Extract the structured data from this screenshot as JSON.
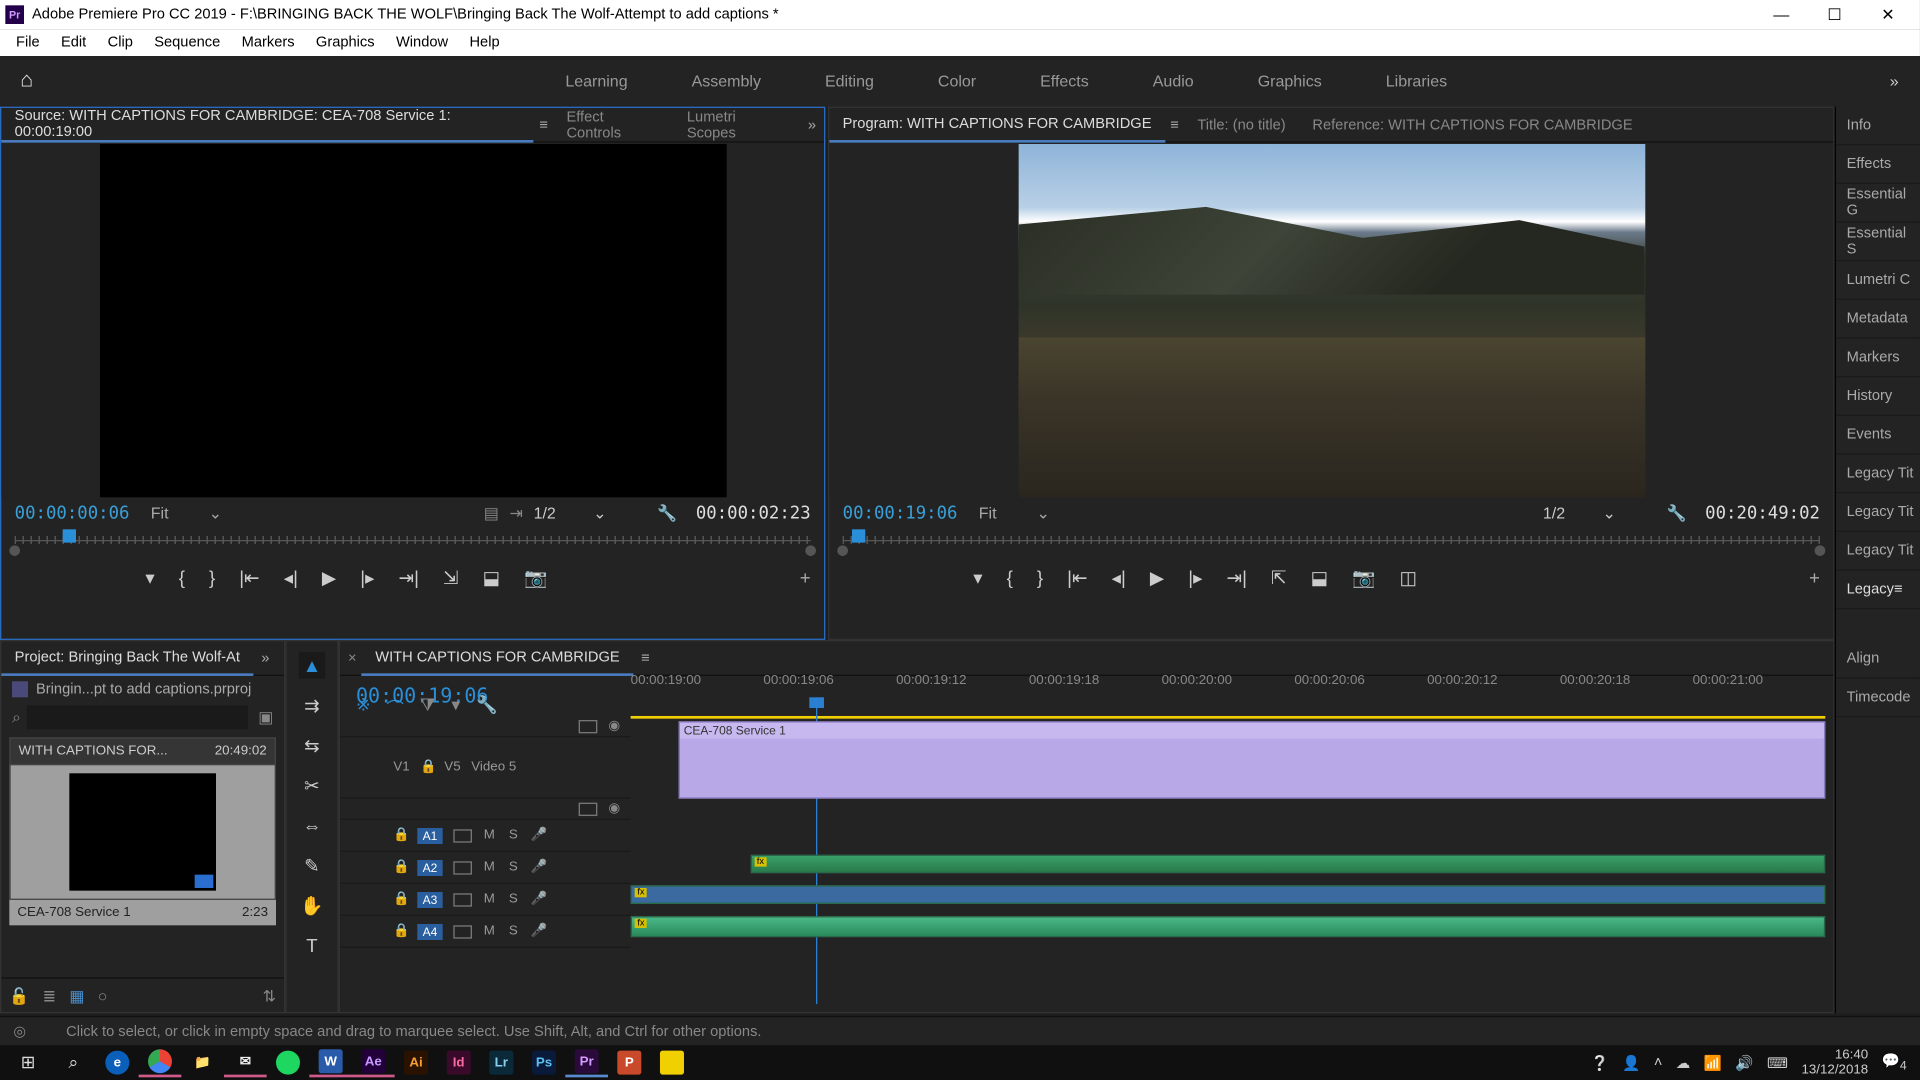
{
  "titlebar": {
    "icon_label": "Pr",
    "title": "Adobe Premiere Pro CC 2019 - F:\\BRINGING BACK THE WOLF\\Bringing Back The Wolf-Attempt to add captions *"
  },
  "menubar": [
    "File",
    "Edit",
    "Clip",
    "Sequence",
    "Markers",
    "Graphics",
    "Window",
    "Help"
  ],
  "workspaces": [
    "Learning",
    "Assembly",
    "Editing",
    "Color",
    "Effects",
    "Audio",
    "Graphics",
    "Libraries"
  ],
  "source": {
    "tab": "Source: WITH CAPTIONS FOR CAMBRIDGE: CEA-708 Service 1: 00:00:19:00",
    "tabs_other": [
      "Effect Controls",
      "Lumetri Scopes"
    ],
    "tc_left": "00:00:00:06",
    "fit": "Fit",
    "frac": "1/2",
    "tc_right": "00:00:02:23"
  },
  "program": {
    "tab": "Program: WITH CAPTIONS FOR CAMBRIDGE",
    "tabs_other": [
      "Title: (no title)",
      "Reference: WITH CAPTIONS FOR CAMBRIDGE"
    ],
    "tc_left": "00:00:19:06",
    "fit": "Fit",
    "frac": "1/2",
    "tc_right": "00:20:49:02"
  },
  "right_panels": [
    "Info",
    "Effects",
    "Essential G",
    "Essential S",
    "Lumetri C",
    "Metadata",
    "Markers",
    "History",
    "Events",
    "Legacy Tit",
    "Legacy Tit",
    "Legacy Tit",
    "Legacy",
    "Align",
    "Timecode"
  ],
  "right_panel_active": 12,
  "project": {
    "tab": "Project: Bringing Back The Wolf-At",
    "file": "Bringin...pt to add captions.prproj",
    "search_placeholder": "",
    "bin_name": "WITH CAPTIONS FOR...",
    "bin_dur": "20:49:02",
    "clip_name": "CEA-708 Service 1",
    "clip_dur": "2:23"
  },
  "timeline": {
    "tab": "WITH CAPTIONS FOR CAMBRIDGE",
    "tc": "00:00:19:06",
    "ruler": [
      "00:00:19:00",
      "00:00:19:06",
      "00:00:19:12",
      "00:00:19:18",
      "00:00:20:00",
      "00:00:20:06",
      "00:00:20:12",
      "00:00:20:18",
      "00:00:21:00"
    ],
    "video_track_label": "Video 5",
    "v_tag": "V1",
    "vs_tag": "V5",
    "caption_clip": "CEA-708 Service 1",
    "audio": [
      "A1",
      "A2",
      "A3",
      "A4"
    ],
    "fx_label": "fx"
  },
  "status": "Click to select, or click in empty space and drag to marquee select. Use Shift, Alt, and Ctrl for other options.",
  "taskbar": {
    "apps": [
      {
        "label": "⊞",
        "bg": "",
        "fg": "#fff"
      },
      {
        "label": "⌕",
        "bg": "",
        "fg": "#fff"
      },
      {
        "label": "e",
        "bg": "#0a5fba",
        "fg": "#fff"
      },
      {
        "label": "●",
        "bg": "",
        "fg": "#f2c43c",
        "chrome": true,
        "under": true
      },
      {
        "label": "📁",
        "bg": "",
        "fg": "#f2c43c"
      },
      {
        "label": "✉",
        "bg": "",
        "fg": "#eee",
        "under": true
      },
      {
        "label": "●",
        "bg": "#1ed760",
        "fg": "#000",
        "round": true
      },
      {
        "label": "W",
        "bg": "#2a5aaa",
        "fg": "#fff",
        "under": true
      },
      {
        "label": "Ae",
        "bg": "#22003a",
        "fg": "#c89aff",
        "under": true
      },
      {
        "label": "Ai",
        "bg": "#2a1200",
        "fg": "#f8a030"
      },
      {
        "label": "Id",
        "bg": "#3a0a2a",
        "fg": "#f86aa0"
      },
      {
        "label": "Lr",
        "bg": "#0a2a3a",
        "fg": "#8ad0f0"
      },
      {
        "label": "Ps",
        "bg": "#0a1a3a",
        "fg": "#5ac0f0"
      },
      {
        "label": "Pr",
        "bg": "#2a0a3a",
        "fg": "#d39aff",
        "under_b": true
      },
      {
        "label": "P",
        "bg": "#c84a2a",
        "fg": "#fff"
      },
      {
        "label": "▦",
        "bg": "#f0d000",
        "fg": "#000"
      }
    ],
    "time": "16:40",
    "date": "13/12/2018",
    "notif": "4"
  }
}
